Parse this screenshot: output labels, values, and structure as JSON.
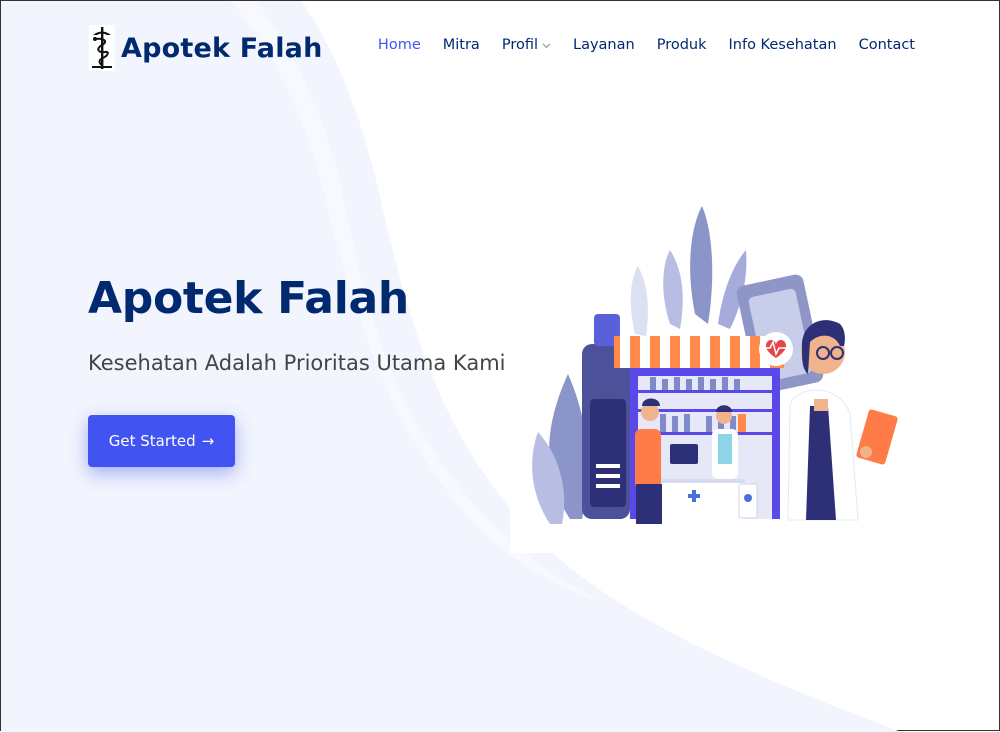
{
  "header": {
    "logo_text": "Apotek Falah",
    "logo_icon": "caduceus-icon",
    "nav": [
      {
        "label": "Home",
        "active": true
      },
      {
        "label": "Mitra",
        "active": false
      },
      {
        "label": "Profil",
        "active": false,
        "dropdown": true
      },
      {
        "label": "Layanan",
        "active": false
      },
      {
        "label": "Produk",
        "active": false
      },
      {
        "label": "Info Kesehatan",
        "active": false
      },
      {
        "label": "Contact",
        "active": false
      }
    ]
  },
  "hero": {
    "title": "Apotek Falah",
    "subtitle": "Kesehatan Adalah Prioritas Utama Kami",
    "cta_label": "Get Started",
    "cta_arrow": "→",
    "illustration": "pharmacy-illustration"
  },
  "colors": {
    "primary": "#4154f1",
    "heading": "#012970",
    "nav_text": "#012970",
    "body_text": "#444444",
    "background_wave": "#f2f5fd"
  }
}
